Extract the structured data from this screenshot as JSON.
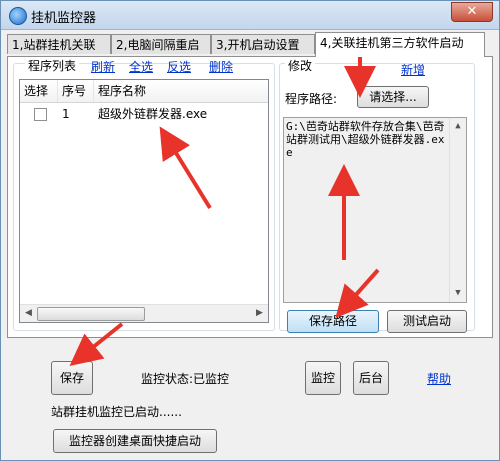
{
  "window": {
    "title": "挂机监控器",
    "close_label": "✕"
  },
  "tabs": [
    {
      "label": "1,站群挂机关联"
    },
    {
      "label": "2,电脑间隔重启"
    },
    {
      "label": "3,开机启动设置"
    },
    {
      "label": "4,关联挂机第三方软件启动"
    }
  ],
  "program_list": {
    "title": "程序列表",
    "links": {
      "refresh": "刷新",
      "select_all": "全选",
      "invert": "反选",
      "delete": "删除"
    },
    "columns": [
      "选择",
      "序号",
      "程序名称"
    ],
    "rows": [
      {
        "checked": false,
        "index": "1",
        "name": "超级外链群发器.exe"
      }
    ]
  },
  "modify": {
    "title": "修改",
    "add_link": "新增",
    "path_label": "程序路径:",
    "choose_button": "请选择...",
    "path_text": "G:\\芭奇站群软件存放合集\\芭奇站群测试用\\超级外链群发器.exe",
    "save_path_button": "保存路径",
    "test_start_button": "测试启动"
  },
  "footer": {
    "save_button": "保存",
    "monitor_status": "监控状态:已监控",
    "monitor_button": "监控",
    "background_button": "后台",
    "help_link": "帮助",
    "status_message": "站群挂机监控已启动......",
    "shortcut_button": "监控器创建桌面快捷启动"
  },
  "accent_colors": {
    "link": "#0033cc",
    "annotation_arrow": "#e8332a"
  }
}
